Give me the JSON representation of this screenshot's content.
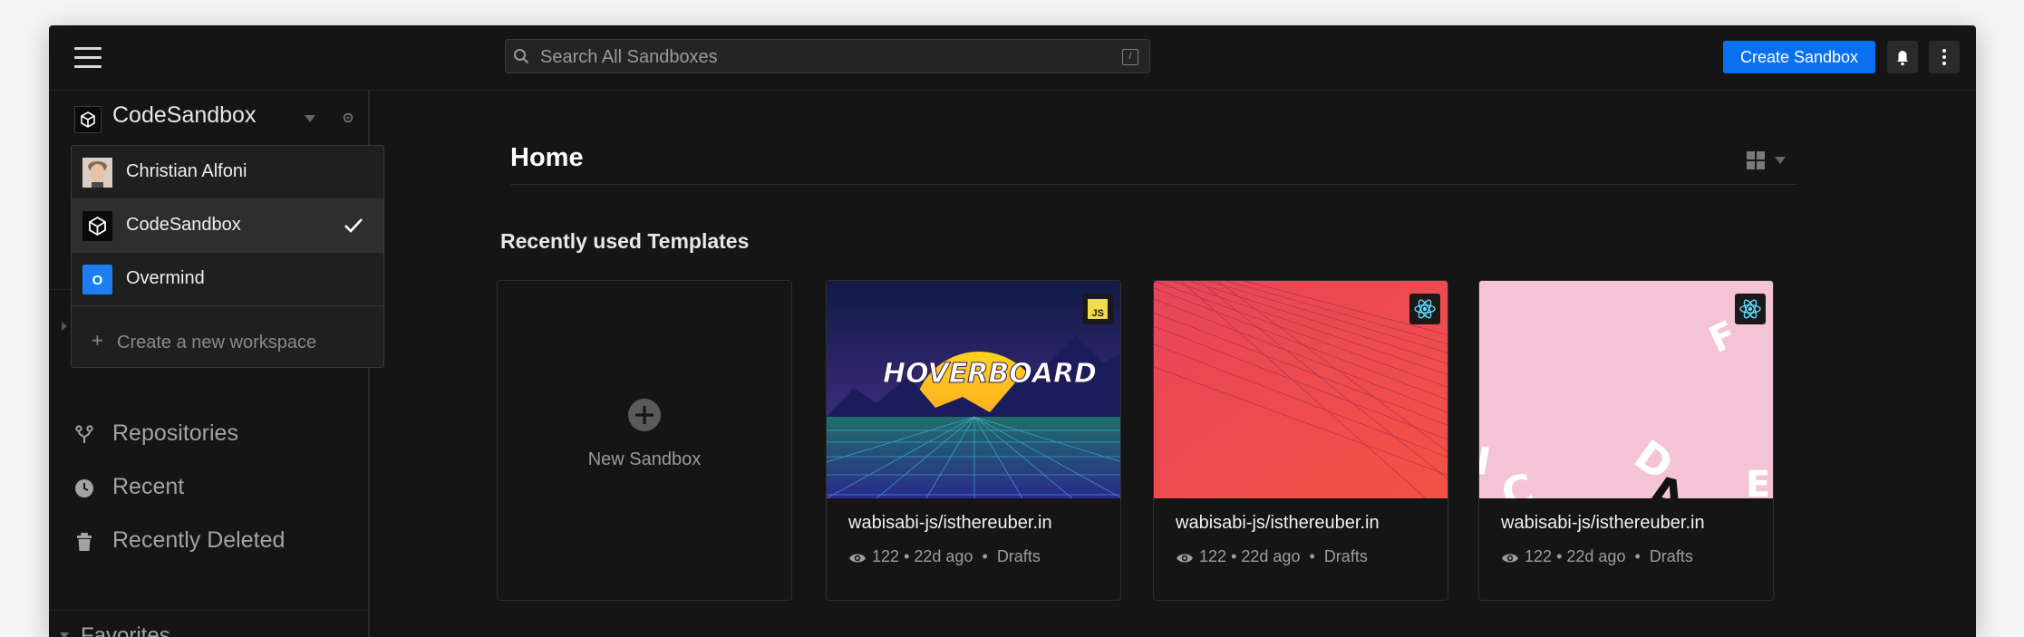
{
  "topbar": {
    "search_placeholder": "Search All Sandboxes",
    "search_shortcut": "/",
    "create_label": "Create Sandbox"
  },
  "workspace": {
    "current": "CodeSandbox"
  },
  "dropdown": {
    "items": [
      {
        "label": "Christian Alfoni",
        "avatar": "photo"
      },
      {
        "label": "CodeSandbox",
        "avatar": "codesandbox-logo",
        "selected": true
      },
      {
        "label": "Overmind",
        "avatar": "O"
      }
    ],
    "new_workspace": "Create a new workspace"
  },
  "sidebar": {
    "items": [
      {
        "label": "Repositories",
        "icon": "fork-icon"
      },
      {
        "label": "Recent",
        "icon": "clock-icon"
      },
      {
        "label": "Recently Deleted",
        "icon": "trash-icon"
      }
    ],
    "favorites": "Favorites"
  },
  "main": {
    "title": "Home",
    "section_title": "Recently used Templates",
    "new_sandbox": "New Sandbox",
    "cards": [
      {
        "title": "wabisabi-js/isthereuber.in",
        "views": "122",
        "age": "22d ago",
        "folder": "Drafts",
        "template": "JS",
        "thumb_text": "HOVERBOARD"
      },
      {
        "title": "wabisabi-js/isthereuber.in",
        "views": "122",
        "age": "22d ago",
        "folder": "Drafts",
        "template": "React"
      },
      {
        "title": "wabisabi-js/isthereuber.in",
        "views": "122",
        "age": "22d ago",
        "folder": "Drafts",
        "template": "React"
      }
    ]
  },
  "colors": {
    "accent": "#0971f1",
    "background": "#151515",
    "overmind": "#1d7ef1",
    "react": "#61dafb",
    "js": "#f0db4f"
  }
}
